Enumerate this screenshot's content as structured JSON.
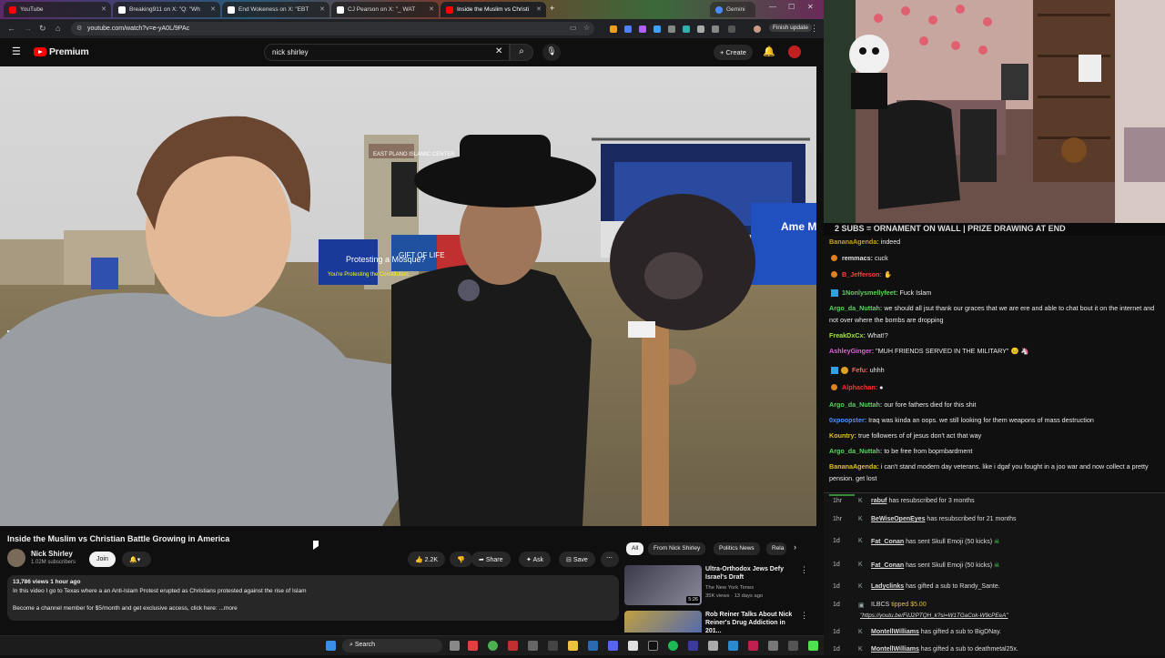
{
  "browser": {
    "tabs": [
      {
        "label": "YouTube",
        "color": "#ff0000"
      },
      {
        "label": "Breaking911 on X: \"Q: \"Wh",
        "color": "#ffffff"
      },
      {
        "label": "End Wokeness on X: \"EBT",
        "color": "#ffffff"
      },
      {
        "label": "CJ Pearson on X: \"_ WAT",
        "color": "#ffffff"
      },
      {
        "label": "Inside the Muslim vs Christi",
        "color": "#ff0000"
      },
      {
        "label": "Gemini",
        "color": "#4a8cff"
      }
    ],
    "url": "youtube.com/watch?v=e-yA0L/9PAc",
    "finish_update": "Finish update"
  },
  "youtube": {
    "logo": "Premium",
    "search_query": "nick shirley",
    "create_label": "Create",
    "video_title": "Inside the Muslim vs Christian Battle Growing in America",
    "channel_name": "Nick Shirley",
    "subscribers": "1.02M subscribers",
    "join_label": "Join",
    "likes": "2.2K",
    "share_label": "Share",
    "ask_label": "Ask",
    "save_label": "Save",
    "desc_meta": "13,786 views  1 hour ago",
    "desc_line1": "In this video I go to Texas where a an Anti-Islam Protest erupted as Christians protested against the rise of Islam",
    "desc_line2": "Become a channel member for $5/month and get exclusive access, click here: ...more",
    "chips": [
      "All",
      "From Nick Shirley",
      "Politics News",
      "Rela"
    ],
    "recs": [
      {
        "title": "Ultra-Orthodox Jews Defy Israel's Draft",
        "channel": "The New York Times",
        "meta": "35K views · 13 days ago",
        "duration": "5:26"
      },
      {
        "title": "Rob Reiner Talks About Nick Reiner's Drug Addiction in 201...",
        "channel": "",
        "meta": "",
        "duration": ""
      }
    ]
  },
  "video_scene": {
    "sign1": "Protesting a Mosque?",
    "sign1b": "You're Protesting the Constitution.",
    "sign2": "GIFT OF LIFE",
    "sign3": "Ame Mus and I",
    "sign4": "EAST PLANO ISLAMIC CENTER"
  },
  "stream": {
    "banner": "2 SUBS = ORNAMENT ON WALL | PRIZE DRAWING AT END",
    "chat": [
      {
        "user": "BananaAgenda:",
        "text": "indeed",
        "color": "#c8a020"
      },
      {
        "user": "remmacs:",
        "text": "cuck",
        "color": "#e0e0e0"
      },
      {
        "user": "B_Jefferson:",
        "text": "",
        "color": "#ff4040"
      },
      {
        "user": "1Nonlysmellyfeet:",
        "text": "Fuck Islam",
        "color": "#60d060"
      },
      {
        "user": "Argo_da_Nuttah:",
        "text": "we should all jsut thank our graces that we are ere and able to chat bout it on the internet and not over where the bombs are dropping",
        "color": "#60d060"
      },
      {
        "user": "FreakDxCx:",
        "text": "What!?",
        "color": "#a0e040"
      },
      {
        "user": "AshleyGinger:",
        "text": "\"MUH FRIENDS SERVED IN THE MILITARY\"",
        "color": "#e060e0"
      },
      {
        "user": "Fefu:",
        "text": "uhhh",
        "color": "#ff6060"
      },
      {
        "user": "Alphachan:",
        "text": "",
        "color": "#ff3030"
      },
      {
        "user": "Argo_da_Nuttah:",
        "text": "our fore fathers died for this shit",
        "color": "#60d060"
      },
      {
        "user": "0xpoopster:",
        "text": "Iraq was kinda an oops. we still looking for them weapons of mass destruction",
        "color": "#5090ff"
      },
      {
        "user": "Kountry:",
        "text": "true followers of of jesus don't act that way",
        "color": "#e0c020"
      },
      {
        "user": "Argo_da_Nuttah:",
        "text": "to be free from bopmbardment",
        "color": "#60d060"
      },
      {
        "user": "BananaAgenda:",
        "text": "i can't stand modern day veterans. like i dgaf you fought in a joo war and now collect a pretty pension. get lost",
        "color": "#e0c020"
      }
    ],
    "events": [
      {
        "time": "1hr",
        "user": "rabuf",
        "text": "has resubscribed for 3 months"
      },
      {
        "time": "1hr",
        "user": "BeWiseOpenEyes",
        "text": "has resubscribed for 21 months"
      },
      {
        "time": "1d",
        "user": "Fat_Conan",
        "text": "has sent Skull Emoji (50 kicks)"
      },
      {
        "time": "1d",
        "user": "Fat_Conan",
        "text": "has sent Skull Emoji (50 kicks)"
      },
      {
        "time": "1d",
        "user": "Ladyclinks",
        "text": "has gifted a sub to Randy_Sante."
      },
      {
        "time": "1d",
        "user": "ILBCS",
        "text": "tipped $5.00"
      },
      {
        "time": "",
        "user": "",
        "text": "\"https://youtu.be/FiIJ2PTQH_k?si=W1TGaCok-W9cPEeA\""
      },
      {
        "time": "1d",
        "user": "MontellWilliams",
        "text": "has gifted a sub to BigDNay."
      },
      {
        "time": "1d",
        "user": "MontellWilliams",
        "text": "has gifted a sub to deathmetal25x."
      }
    ]
  },
  "taskbar": {
    "search_label": "Search"
  }
}
